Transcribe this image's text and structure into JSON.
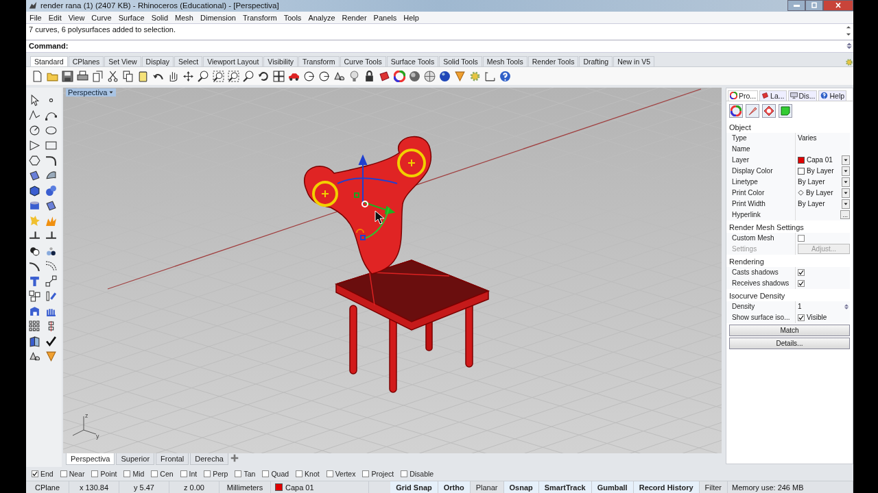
{
  "window": {
    "title": "render rana (1) (2407 KB) - Rhinoceros (Educational) - [Perspectiva]"
  },
  "menu": [
    "File",
    "Edit",
    "View",
    "Curve",
    "Surface",
    "Solid",
    "Mesh",
    "Dimension",
    "Transform",
    "Tools",
    "Analyze",
    "Render",
    "Panels",
    "Help"
  ],
  "command_history": "7 curves, 6 polysurfaces added to selection.",
  "command_prompt": "Command:",
  "toolbar_tabs": [
    {
      "label": "Standard",
      "selected": true
    },
    {
      "label": "CPlanes",
      "selected": false
    },
    {
      "label": "Set View",
      "selected": false
    },
    {
      "label": "Display",
      "selected": false
    },
    {
      "label": "Select",
      "selected": false
    },
    {
      "label": "Viewport Layout",
      "selected": false
    },
    {
      "label": "Visibility",
      "selected": false
    },
    {
      "label": "Transform",
      "selected": false
    },
    {
      "label": "Curve Tools",
      "selected": false
    },
    {
      "label": "Surface Tools",
      "selected": false
    },
    {
      "label": "Solid Tools",
      "selected": false
    },
    {
      "label": "Mesh Tools",
      "selected": false
    },
    {
      "label": "Render Tools",
      "selected": false
    },
    {
      "label": "Drafting",
      "selected": false
    },
    {
      "label": "New in V5",
      "selected": false
    }
  ],
  "viewport": {
    "title": "Perspectiva",
    "axis_labels": [
      "z",
      "y"
    ]
  },
  "viewport_tabs": [
    {
      "label": "Perspectiva",
      "selected": true
    },
    {
      "label": "Superior",
      "selected": false
    },
    {
      "label": "Frontal",
      "selected": false
    },
    {
      "label": "Derecha",
      "selected": false
    }
  ],
  "properties_panel": {
    "tabs": [
      {
        "label": "Pro...",
        "selected": true
      },
      {
        "label": "La...",
        "selected": false
      },
      {
        "label": "Dis...",
        "selected": false
      },
      {
        "label": "Help",
        "selected": false
      }
    ],
    "sections": [
      {
        "title": "Object",
        "rows": [
          {
            "kind": "text",
            "label": "Type",
            "value": "Varies",
            "disabled": false
          },
          {
            "kind": "text",
            "label": "Name",
            "disabled": false
          },
          {
            "kind": "swatch_dropdown",
            "label": "Layer",
            "value": "Capa 01",
            "color": "#e00000",
            "disabled": false
          },
          {
            "kind": "swatch_dropdown",
            "label": "Display Color",
            "value": "By Layer",
            "color": "#ffffff",
            "disabled": false
          },
          {
            "kind": "dropdown",
            "label": "Linetype",
            "value": "By Layer",
            "disabled": false
          },
          {
            "kind": "diamond_dropdown",
            "label": "Print Color",
            "value": "By Layer",
            "disabled": false
          },
          {
            "kind": "dropdown",
            "label": "Print Width",
            "value": "By Layer",
            "disabled": false
          },
          {
            "kind": "ellipsis",
            "label": "Hyperlink",
            "action": "...",
            "disabled": false
          }
        ]
      },
      {
        "title": "Render Mesh Settings",
        "rows": [
          {
            "kind": "checkbox",
            "label": "Custom Mesh",
            "checked": false,
            "disabled": false
          },
          {
            "kind": "button",
            "label": "Settings",
            "action": "Adjust...",
            "disabled": true
          }
        ]
      },
      {
        "title": "Rendering",
        "rows": [
          {
            "kind": "checkbox",
            "label": "Casts shadows",
            "checked": true,
            "disabled": false
          },
          {
            "kind": "checkbox",
            "label": "Receives shadows",
            "checked": true,
            "disabled": false
          }
        ]
      },
      {
        "title": "Isocurve Density",
        "rows": [
          {
            "kind": "spinner",
            "label": "Density",
            "value": "1",
            "disabled": false
          },
          {
            "kind": "checkbox",
            "label": "Show surface iso...",
            "checked": true,
            "text": "Visible",
            "disabled": false
          }
        ]
      }
    ],
    "buttons": [
      "Match",
      "Details..."
    ]
  },
  "osnaps": [
    {
      "label": "End",
      "checked": true
    },
    {
      "label": "Near",
      "checked": false
    },
    {
      "label": "Point",
      "checked": false
    },
    {
      "label": "Mid",
      "checked": false
    },
    {
      "label": "Cen",
      "checked": false
    },
    {
      "label": "Int",
      "checked": false
    },
    {
      "label": "Perp",
      "checked": false
    },
    {
      "label": "Tan",
      "checked": false
    },
    {
      "label": "Quad",
      "checked": false
    },
    {
      "label": "Knot",
      "checked": false
    },
    {
      "label": "Vertex",
      "checked": false
    },
    {
      "label": "Project",
      "checked": false
    },
    {
      "label": "Disable",
      "checked": false
    }
  ],
  "status_bar": {
    "cplane": "CPlane",
    "x": "x 130.84",
    "y": "y 5.47",
    "z": "z 0.00",
    "units": "Millimeters",
    "layer": {
      "name": "Capa 01",
      "color": "#e00000"
    },
    "toggles": [
      {
        "label": "Grid Snap",
        "on": true
      },
      {
        "label": "Ortho",
        "on": true
      },
      {
        "label": "Planar",
        "on": false
      },
      {
        "label": "Osnap",
        "on": true
      },
      {
        "label": "SmartTrack",
        "on": true
      },
      {
        "label": "Gumball",
        "on": true
      },
      {
        "label": "Record History",
        "on": true
      },
      {
        "label": "Filter",
        "on": false
      }
    ],
    "memory": "Memory use: 246 MB"
  }
}
